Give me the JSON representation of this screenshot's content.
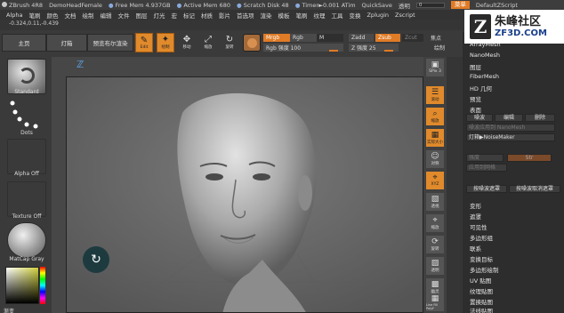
{
  "titlebar": {
    "app": "ZBrush 4R8",
    "document": "DemoHeadFemale",
    "free_mem": "Free Mem 4.937GB",
    "active_mem": "Active Mem 680",
    "scratch_disk": "Scratch Disk 48",
    "timer": "Timer►0.001 ATim",
    "quicksave": "QuickSave",
    "transparency_label": "透明",
    "transparency_value": "0",
    "menus_btn": "菜单",
    "default_script": "DefaultZScript"
  },
  "menubar": [
    "Alpha",
    "笔刷",
    "颜色",
    "文档",
    "绘制",
    "编辑",
    "文件",
    "图层",
    "灯光",
    "宏",
    "标记",
    "材质",
    "影片",
    "首选项",
    "渲染",
    "模板",
    "笔刷",
    "纹理",
    "工具",
    "变换",
    "Zplugin",
    "Zscript"
  ],
  "coords": "-0.324,0.11,-0.439",
  "logo": {
    "mark": "Z",
    "line1": "朱峰社区",
    "line2": "ZF3D.COM"
  },
  "shelf": {
    "home": "主页",
    "lightbox": "灯箱",
    "preview_render": "预览布尔渲染",
    "tools": [
      {
        "label": "Edit",
        "glyph": "✎"
      },
      {
        "label": "移动",
        "glyph": "✥"
      },
      {
        "label": "缩放",
        "glyph": "⤢"
      },
      {
        "label": "旋转",
        "glyph": "↻"
      }
    ],
    "draw_label": "绘制",
    "mrgb": "Mrgb",
    "rgb": "Rgb",
    "m": "M",
    "rgb_intensity": "Rgb 强度 100",
    "zadd": "Zadd",
    "zsub": "Zsub",
    "zcut": "Zcut",
    "z_intensity": "Z 强度 25",
    "focal_shift": "焦点",
    "draw_size": "绘制"
  },
  "leftshelf": {
    "brush": "Standard",
    "stroke": "Dots",
    "alpha": "Alpha Off",
    "texture": "Texture Off",
    "material": "MatCap Gray",
    "gradient": "渐变"
  },
  "rightstrip": [
    {
      "label": "SPix 3",
      "glyph": "▣"
    },
    {
      "label": "滚动",
      "glyph": "☰"
    },
    {
      "label": "缩放",
      "glyph": "⌕"
    },
    {
      "label": "实际大小",
      "glyph": "▦"
    },
    {
      "label": "对称",
      "glyph": "☺"
    },
    {
      "label": "透视",
      "glyph": "▧"
    },
    {
      "label": "XYZ",
      "glyph": "⌖"
    },
    {
      "label": "缩放",
      "glyph": "⌖"
    },
    {
      "label": "旋转",
      "glyph": "⟳"
    },
    {
      "label": "透明",
      "glyph": "▨"
    },
    {
      "label": "幽灵",
      "glyph": "▩"
    },
    {
      "label": "Line Fill PolyF",
      "glyph": "▦"
    },
    {
      "label": "透明",
      "glyph": "▥"
    }
  ],
  "rightpanel": {
    "top_items": [
      "ArrayMesh",
      "NanoMesh",
      "图层",
      "FiberMesh",
      "HD 几何",
      "预览",
      "表面"
    ],
    "noise_btn": "噪波",
    "edit_btn": "编辑",
    "delete_btn": "删除",
    "apply_to_nanomesh": "噪波应用到 NanoMesh",
    "noisemaker": "灯箱▶NoiseMaker",
    "strength": "强度",
    "strength_value": "Str",
    "apply_to_mesh": "应用到网格",
    "noise_to_mask": "按噪波遮罩",
    "noise_unmask": "按噪波取消遮罩",
    "bottom_items": [
      "变形",
      "遮罩",
      "可见性",
      "多边形组",
      "联系",
      "变换目标",
      "多边形绘制",
      "UV 贴图",
      "纹理贴图",
      "置换贴图",
      "法线贴图"
    ]
  }
}
